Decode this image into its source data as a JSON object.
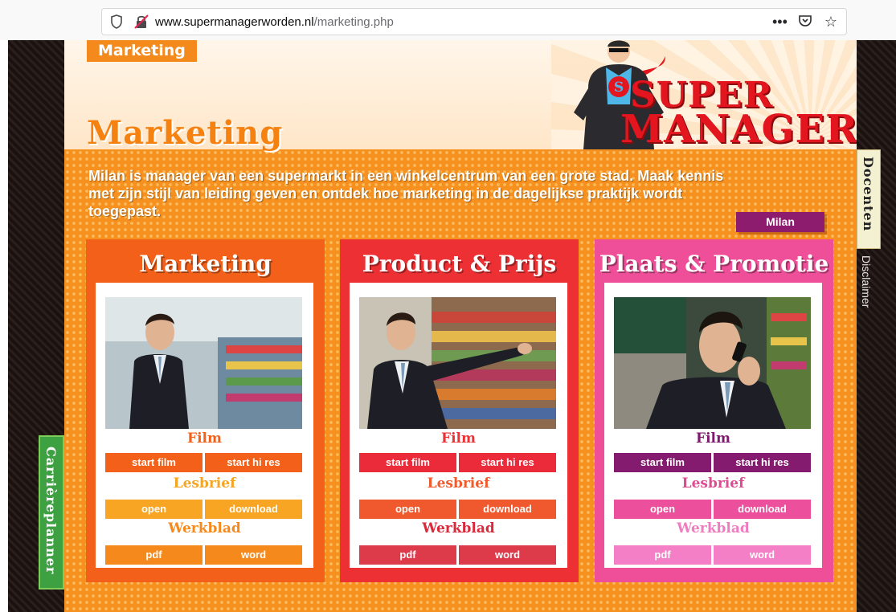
{
  "browser": {
    "url_domain": "www.supermanagerworden.nl",
    "url_path": "/marketing.php",
    "icons": [
      "shield-icon",
      "insecure-lock-icon",
      "more-icon",
      "pocket-icon",
      "bookmark-star-icon"
    ]
  },
  "header": {
    "tag": "Marketing",
    "title": "Marketing",
    "logo_line1": "SUPER",
    "logo_line2": "MANAGER"
  },
  "intro": {
    "text": "Milan is manager van een supermarkt in een winkelcentrum van een grote stad. Maak kennis met zijn stijl van leiding geven en ontdek hoe marketing in de dagelijkse praktijk wordt toegepast.",
    "milan_button": "Milan"
  },
  "cards": [
    {
      "title": "Marketing",
      "film_label": "Film",
      "start_film": "start film",
      "start_hi_res": "start hi res",
      "lesbrief_label": "Lesbrief",
      "open": "open",
      "download": "download",
      "werkblad_label": "Werkblad",
      "pdf": "pdf",
      "word": "word"
    },
    {
      "title": "Product & Prijs",
      "film_label": "Film",
      "start_film": "start film",
      "start_hi_res": "start hi res",
      "lesbrief_label": "Lesbrief",
      "open": "open",
      "download": "download",
      "werkblad_label": "Werkblad",
      "pdf": "pdf",
      "word": "word"
    },
    {
      "title": "Plaats & Promotie",
      "film_label": "Film",
      "start_film": "start film",
      "start_hi_res": "start hi res",
      "lesbrief_label": "Lesbrief",
      "open": "open",
      "download": "download",
      "werkblad_label": "Werkblad",
      "pdf": "pdf",
      "word": "word"
    }
  ],
  "side_tabs": {
    "docenten": "Docenten",
    "disclaimer": "Disclaimer",
    "carriereplanner": "Carrièreplanner"
  },
  "colors": {
    "orange": "#f6901e",
    "card1": "#f2601a",
    "card2": "#ec3034",
    "card3": "#ee4f98",
    "logo_red": "#e3161f",
    "milan_purple": "#8d1c6e"
  }
}
